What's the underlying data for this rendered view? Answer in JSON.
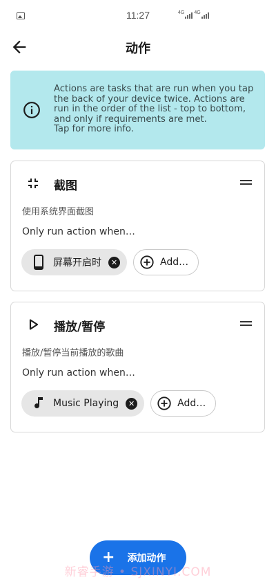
{
  "status_bar": {
    "time": "11:27",
    "signal_1_label": "4G",
    "signal_2_label": "4G",
    "notification_icon": "gallery-icon"
  },
  "header": {
    "title": "动作",
    "back_icon": "arrow-left-icon"
  },
  "info_banner": {
    "icon": "info-circle-icon",
    "text": "Actions are tasks that are run when you tap the back of your device twice. Actions are run in the order of the list - top to bottom, and only if requirements are met.",
    "more": "Tap for more info."
  },
  "actions": [
    {
      "icon": "screenshot-compress-icon",
      "title": "截图",
      "description": "使用系统界面截图",
      "condition_label": "Only run action when…",
      "requirement": {
        "icon": "phone-icon",
        "label": "屏幕开启时"
      },
      "add_label": "Add…"
    },
    {
      "icon": "play-icon",
      "title": "播放/暂停",
      "description": "播放/暂停当前播放的歌曲",
      "condition_label": "Only run action when…",
      "requirement": {
        "icon": "music-note-icon",
        "label": "Music Playing"
      },
      "add_label": "Add…"
    }
  ],
  "fab": {
    "icon": "plus-icon",
    "label": "添加动作"
  },
  "watermark": "新睿手游 • SJXINYI.COM",
  "colors": {
    "banner_bg": "#b3e8ed",
    "fab_bg": "#1a73e8",
    "chip_bg": "#e6e6e6"
  }
}
